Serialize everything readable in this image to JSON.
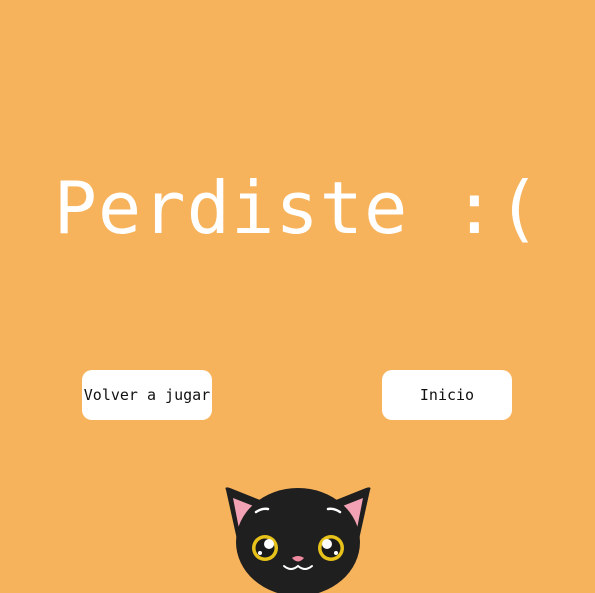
{
  "game_over": {
    "title": "Perdiste :("
  },
  "buttons": {
    "retry_label": "Volver a jugar",
    "home_label": "Inicio"
  },
  "colors": {
    "background": "#f7b35c",
    "button_bg": "#ffffff",
    "title_text": "#ffffff",
    "cat_fur": "#1f1f1f",
    "cat_ear_inner": "#f2a2b4",
    "cat_eye": "#e6c21a"
  },
  "mascot": {
    "icon": "black-cat-icon"
  }
}
